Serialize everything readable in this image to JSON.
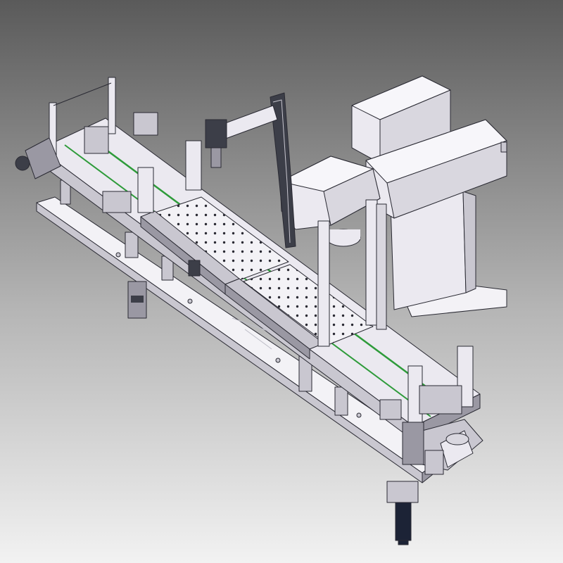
{
  "view": {
    "background_top": "#5a5a5a",
    "background_bottom": "#f2f2f2",
    "part_fill": "#ebe9f0",
    "part_shade": "#c9c7d0",
    "part_dark": "#9a98a3",
    "edge_color": "#2a2a33",
    "belt_accent": "#2e9b3a",
    "motor_color": "#1c2336",
    "plate_fill": "#f3f2f6"
  }
}
